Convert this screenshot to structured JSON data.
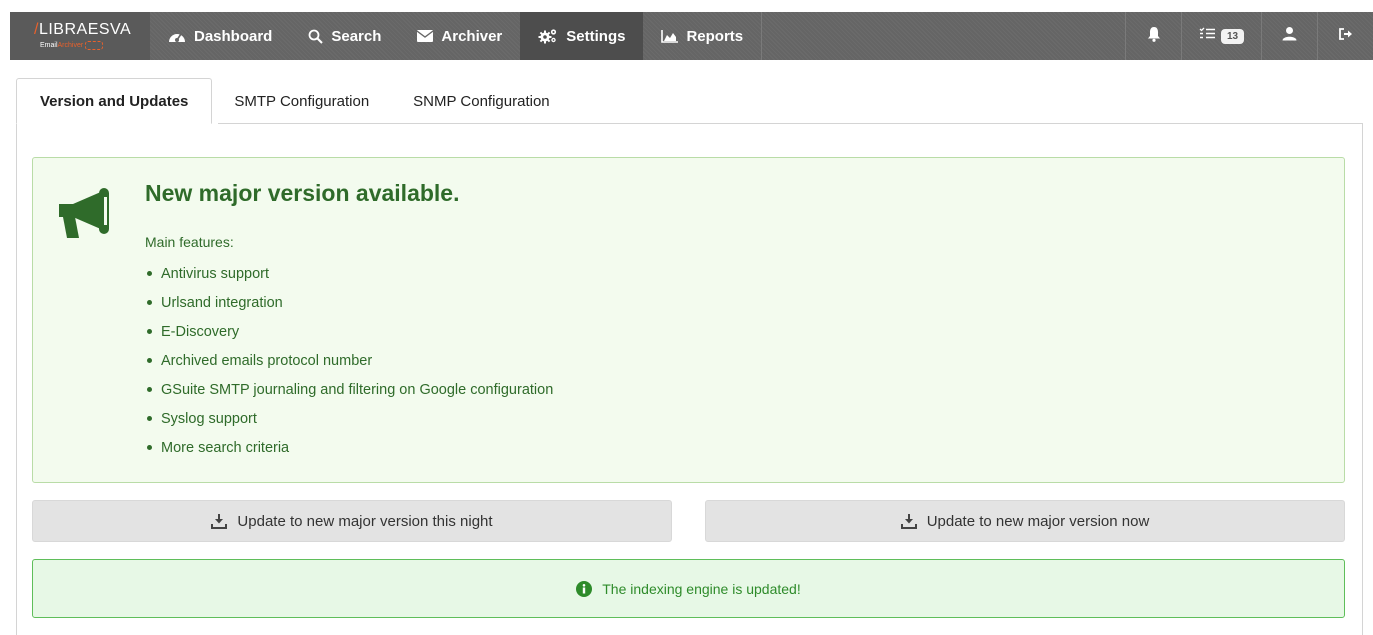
{
  "brand": {
    "name_prefix": "/",
    "name": "LIBRAESVA",
    "sub_email": "Email",
    "sub_archiver": "Archiver"
  },
  "nav": {
    "items": [
      {
        "label": "Dashboard",
        "icon": "dashboard-icon"
      },
      {
        "label": "Search",
        "icon": "search-icon"
      },
      {
        "label": "Archiver",
        "icon": "envelope-icon"
      },
      {
        "label": "Settings",
        "icon": "gears-icon"
      },
      {
        "label": "Reports",
        "icon": "area-chart-icon"
      }
    ],
    "active": "Settings",
    "tasks_count": "13"
  },
  "tabs": [
    {
      "label": "Version and Updates"
    },
    {
      "label": "SMTP Configuration"
    },
    {
      "label": "SNMP Configuration"
    }
  ],
  "announcement": {
    "title": "New major version available.",
    "features_title": "Main features:",
    "features": [
      "Antivirus support",
      "Urlsand integration",
      "E-Discovery",
      "Archived emails protocol number",
      "GSuite SMTP journaling and filtering on Google configuration",
      "Syslog support",
      "More search criteria"
    ]
  },
  "buttons": {
    "update_night": "Update to new major version this night",
    "update_now": "Update to new major version now"
  },
  "status": {
    "message": "The indexing engine is updated!"
  },
  "colors": {
    "success_green": "#2e8b2a",
    "feature_green": "#2f6b2a",
    "brand_orange": "#e8612c"
  }
}
